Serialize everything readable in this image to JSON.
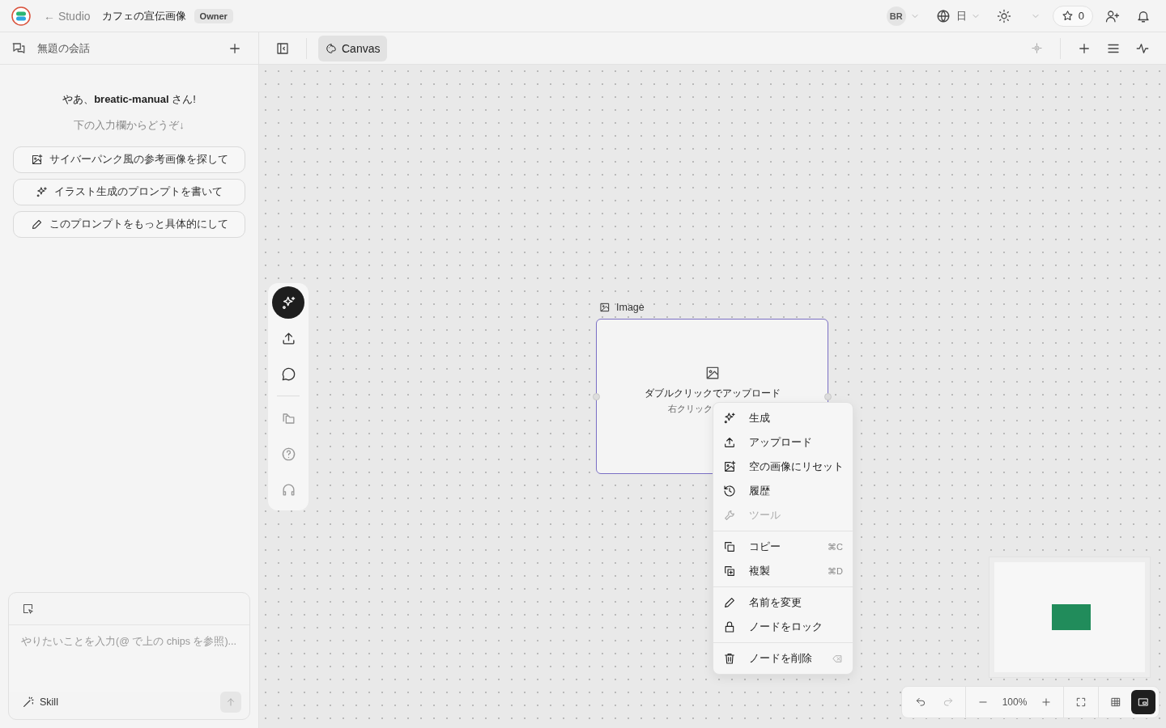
{
  "top_bar": {
    "back_link": "← Studio",
    "project_title": "カフェの宣伝画像",
    "role_badge": "Owner",
    "avatar": "BR",
    "language": "日",
    "star_count": "0"
  },
  "sidebar": {
    "conversation_title": "無題の会話",
    "greeting": "やあ、**breatic-manual** さん!",
    "hint": "下の入力欄からどうぞ↓",
    "suggestions": [
      "サイバーパンク風の参考画像を探して",
      "イラスト生成のプロンプトを書いて",
      "このプロンプトをもっと具体的にして"
    ],
    "composer": {
      "placeholder": "やりたいことを入力(@ で上の chips を参照)...",
      "skill_button": "Skill",
      "send_disabled": true
    }
  },
  "canvas_tabs": [
    {
      "label": "Canvas",
      "selected": true
    }
  ],
  "tools": [
    {
      "selected": true
    },
    {
      "selected": false
    },
    {
      "selected": false
    },
    {
      "selected": false
    },
    {
      "selected": false
    },
    {
      "selected": false
    }
  ],
  "node": {
    "title": "Image",
    "upload_hint": "ダブルクリックでアップロード",
    "secondary_hint": "右クリック"
  },
  "context_menu": [
    [
      {
        "label": "生成",
        "disabled": false
      },
      {
        "label": "アップロード",
        "disabled": false
      },
      {
        "label": "空の画像にリセット",
        "disabled": false
      },
      {
        "label": "履歴",
        "disabled": false
      },
      {
        "label": "ツール",
        "disabled": true
      }
    ],
    [
      {
        "label": "コピー",
        "shortcut": "⌘C",
        "disabled": false
      },
      {
        "label": "複製",
        "shortcut": "⌘D",
        "disabled": false
      }
    ],
    [
      {
        "label": "名前を変更",
        "disabled": false
      },
      {
        "label": "ノードをロック",
        "disabled": false
      }
    ],
    [
      {
        "label": "ノードを削除",
        "disabled": false
      }
    ]
  ],
  "zoom_bar": {
    "zoom": "100%",
    "undo_disabled": false,
    "redo_disabled": true,
    "minimap_on": true
  }
}
